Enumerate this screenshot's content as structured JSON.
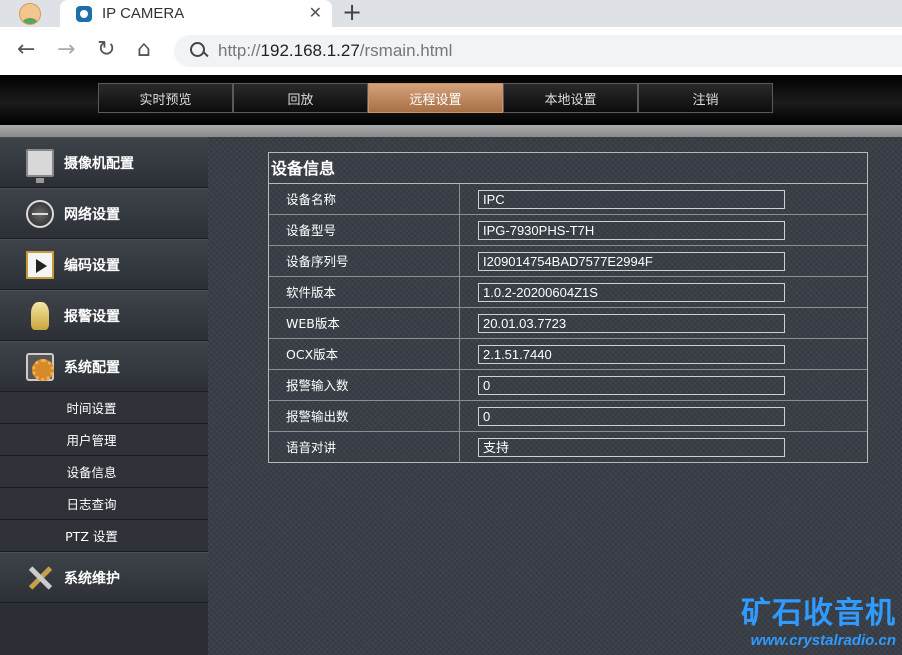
{
  "browser": {
    "tab_title": "IP CAMERA",
    "tab_close": "✕",
    "new_tab": "+",
    "back": "←",
    "forward": "→",
    "reload": "↻",
    "home": "⌂",
    "url_scheme": "http://",
    "url_host": "192.168.1.27",
    "url_path": "/rsmain.html"
  },
  "topnav": {
    "items": [
      {
        "label": "实时预览"
      },
      {
        "label": "回放"
      },
      {
        "label": "远程设置",
        "active": true
      },
      {
        "label": "本地设置"
      },
      {
        "label": "注销"
      }
    ]
  },
  "sidebar": {
    "camera_config": "摄像机配置",
    "network": "网络设置",
    "encoding": "编码设置",
    "alarm": "报警设置",
    "system_config": "系统配置",
    "sub_items": [
      "时间设置",
      "用户管理",
      "设备信息",
      "日志查询",
      "PTZ 设置"
    ],
    "maintenance": "系统维护"
  },
  "device_info": {
    "title": "设备信息",
    "rows": [
      {
        "label": "设备名称",
        "value": "IPC"
      },
      {
        "label": "设备型号",
        "value": "IPG-7930PHS-T7H"
      },
      {
        "label": "设备序列号",
        "value": "I209014754BAD7577E2994F"
      },
      {
        "label": "软件版本",
        "value": "1.0.2-20200604Z1S"
      },
      {
        "label": "WEB版本",
        "value": "20.01.03.7723"
      },
      {
        "label": "OCX版本",
        "value": "2.1.51.7440"
      },
      {
        "label": "报警输入数",
        "value": "0"
      },
      {
        "label": "报警输出数",
        "value": "0"
      },
      {
        "label": "语音对讲",
        "value": "支持"
      }
    ]
  },
  "watermark": {
    "title": "矿石收音机",
    "url": "www.crystalradio.cn"
  },
  "colors": {
    "active_tab": "#c08b62",
    "watermark": "#2f9bff"
  }
}
